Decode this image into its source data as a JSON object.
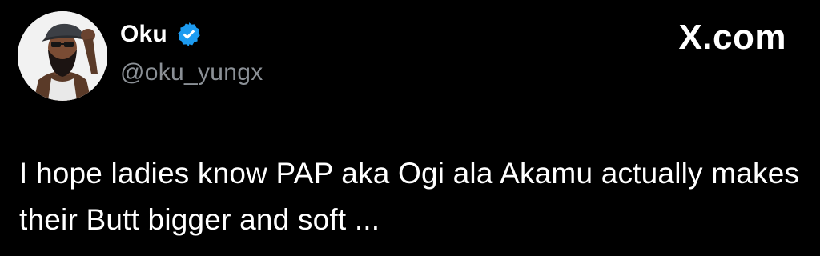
{
  "tweet": {
    "display_name": "Oku",
    "handle": "@oku_yungx",
    "verified": true,
    "verified_badge_icon": "verified-check-icon",
    "verified_badge_color": "#1d9bf0",
    "brand": "X.com",
    "text": "I hope ladies know PAP aka Ogi ala Akamu actually makes their Butt bigger and soft ...",
    "background_color": "#000000",
    "handle_color": "#8b9096"
  }
}
